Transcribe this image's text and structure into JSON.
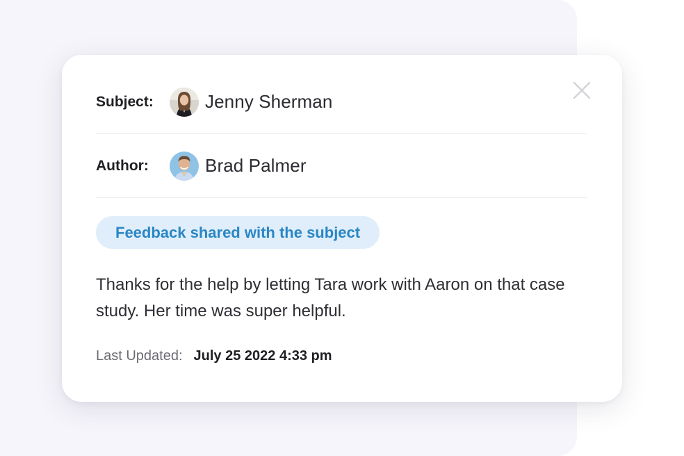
{
  "dialog": {
    "subject": {
      "label": "Subject:",
      "name": "Jenny Sherman"
    },
    "author": {
      "label": "Author:",
      "name": "Brad Palmer"
    },
    "badge": "Feedback shared with the subject",
    "message": "Thanks for the help by letting Tara work with Aaron on that case study. Her time was super helpful.",
    "last_updated": {
      "label": "Last Updated:",
      "value": "July 25 2022 4:33 pm"
    },
    "close_icon": "close-icon"
  },
  "colors": {
    "badge_bg": "#dfeefa",
    "badge_text": "#2a86c4",
    "backdrop": "#f6f5fb"
  }
}
